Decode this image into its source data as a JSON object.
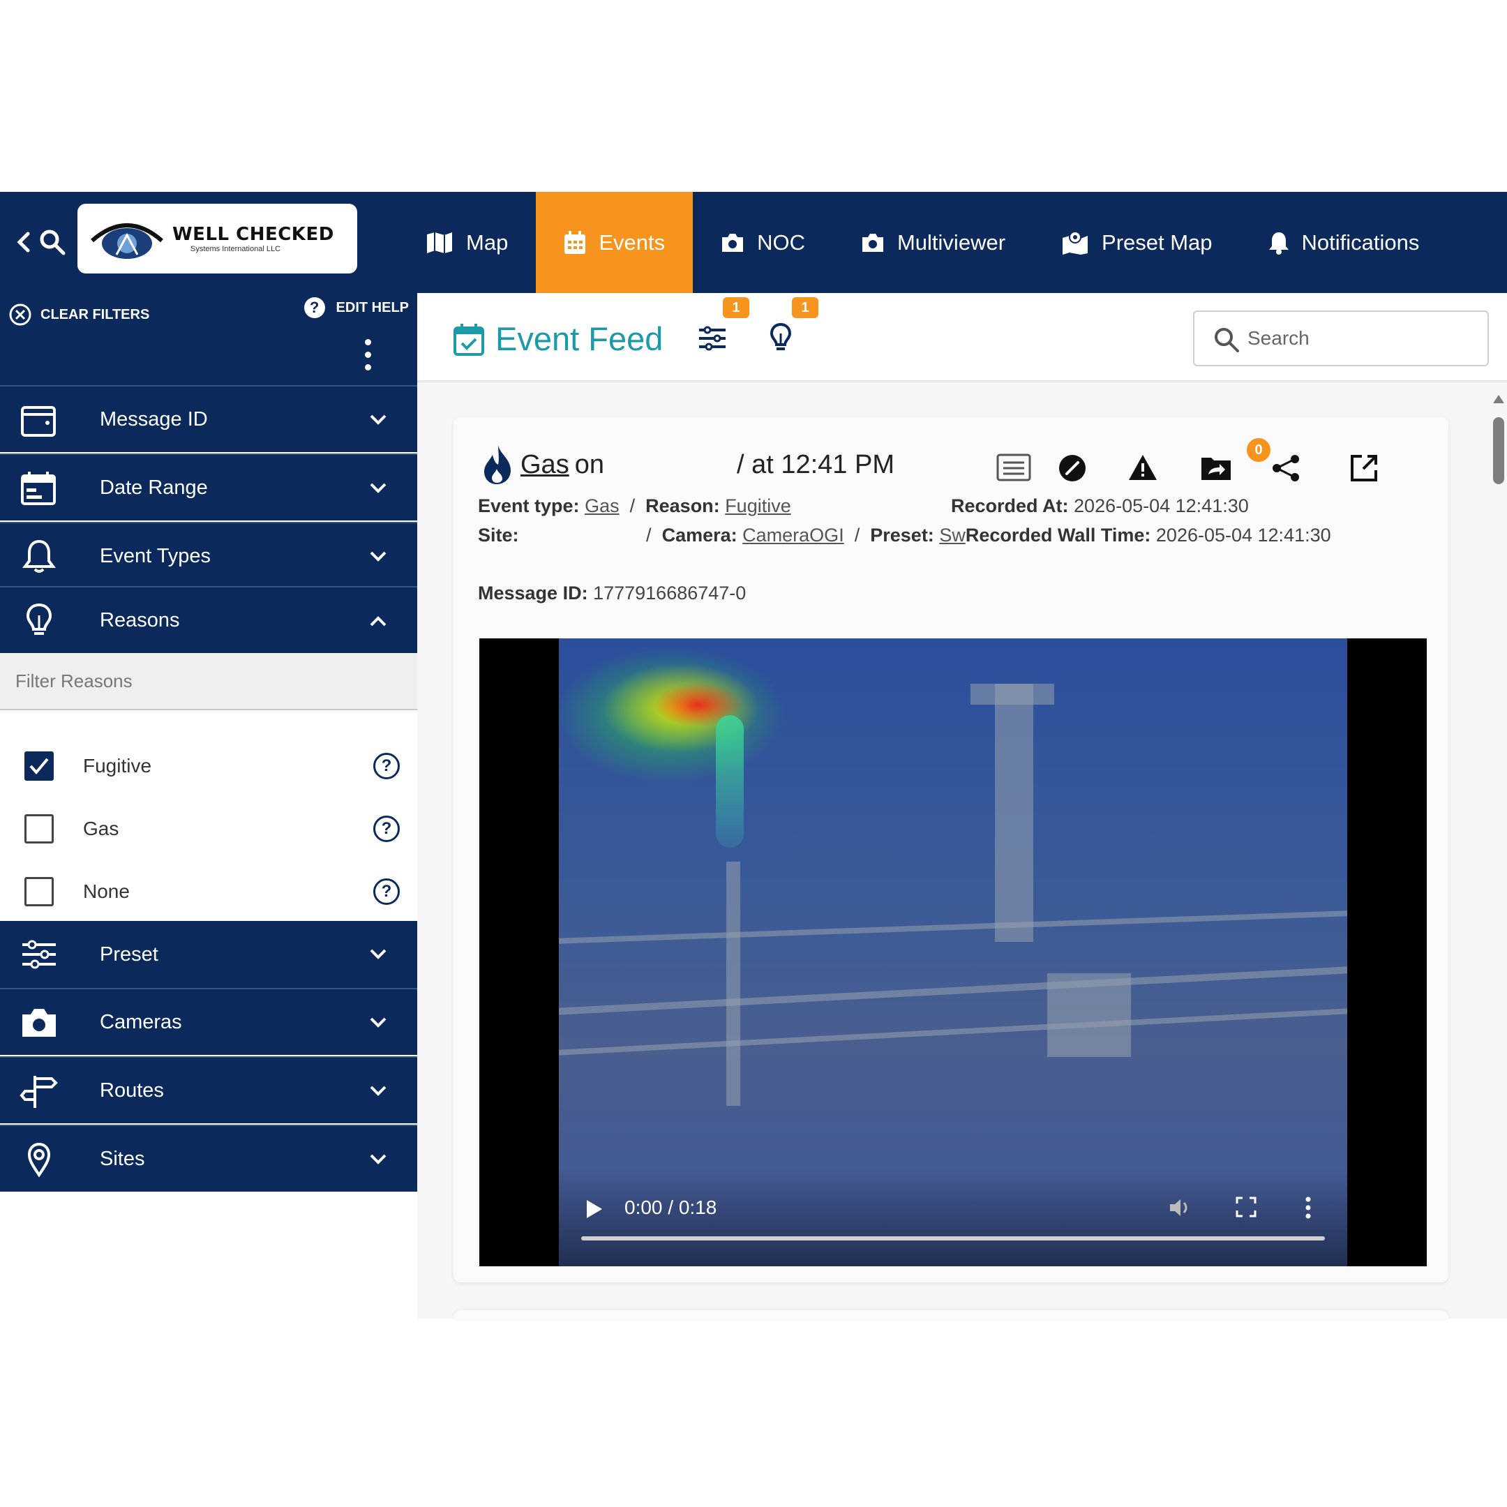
{
  "logo": {
    "name": "WELL CHECKED",
    "tagline": "Systems International LLC"
  },
  "nav": {
    "items": [
      {
        "label": "Map",
        "icon": "map-icon",
        "active": false
      },
      {
        "label": "Events",
        "icon": "calendar-icon",
        "active": true
      },
      {
        "label": "NOC",
        "icon": "camera-icon",
        "active": false
      },
      {
        "label": "Multiviewer",
        "icon": "camera-icon",
        "active": false
      },
      {
        "label": "Preset Map",
        "icon": "map-pin-icon",
        "active": false
      },
      {
        "label": "Notifications",
        "icon": "bell-icon",
        "active": false
      }
    ]
  },
  "sidebar": {
    "clear_filters": "CLEAR FILTERS",
    "edit_help": "EDIT HELP",
    "sections": [
      {
        "label": "Message ID",
        "icon": "wallet-icon",
        "expanded": false
      },
      {
        "label": "Date Range",
        "icon": "date-range-icon",
        "expanded": false
      },
      {
        "label": "Event Types",
        "icon": "bell-icon",
        "expanded": false
      },
      {
        "label": "Reasons",
        "icon": "lightbulb-icon",
        "expanded": true
      },
      {
        "label": "Preset",
        "icon": "sliders-icon",
        "expanded": false
      },
      {
        "label": "Cameras",
        "icon": "camera-icon",
        "expanded": false
      },
      {
        "label": "Routes",
        "icon": "signpost-icon",
        "expanded": false
      },
      {
        "label": "Sites",
        "icon": "location-pin-icon",
        "expanded": false
      }
    ],
    "reasons_filter_placeholder": "Filter Reasons",
    "reasons": [
      {
        "label": "Fugitive",
        "checked": true
      },
      {
        "label": "Gas",
        "checked": false
      },
      {
        "label": "None",
        "checked": false
      }
    ]
  },
  "header": {
    "title": "Event Feed",
    "filter_badge": "1",
    "reason_badge": "1",
    "search_placeholder": "Search"
  },
  "event": {
    "title_type": "Gas",
    "title_on": "on",
    "title_time": "/ at 12:41 PM",
    "forward_badge": "0",
    "event_type_label": "Event type:",
    "event_type_value": "Gas",
    "reason_label": "Reason:",
    "reason_value": "Fugitive",
    "recorded_at_label": "Recorded At:",
    "recorded_at_value": "2026-05-04 12:41:30",
    "site_label": "Site:",
    "camera_label": "Camera:",
    "camera_value": "CameraOGI",
    "preset_label": "Preset:",
    "preset_value": "Sw",
    "wall_time_label": "Recorded Wall Time:",
    "wall_time_value": "2026-05-04 12:41:30",
    "message_id_label": "Message ID:",
    "message_id_value": "1777916686747-0",
    "video_time": "0:00 / 0:18"
  },
  "colors": {
    "navy": "#0b2a5b",
    "accent_orange": "#f7941d",
    "teal_title": "#1b9aa8"
  }
}
